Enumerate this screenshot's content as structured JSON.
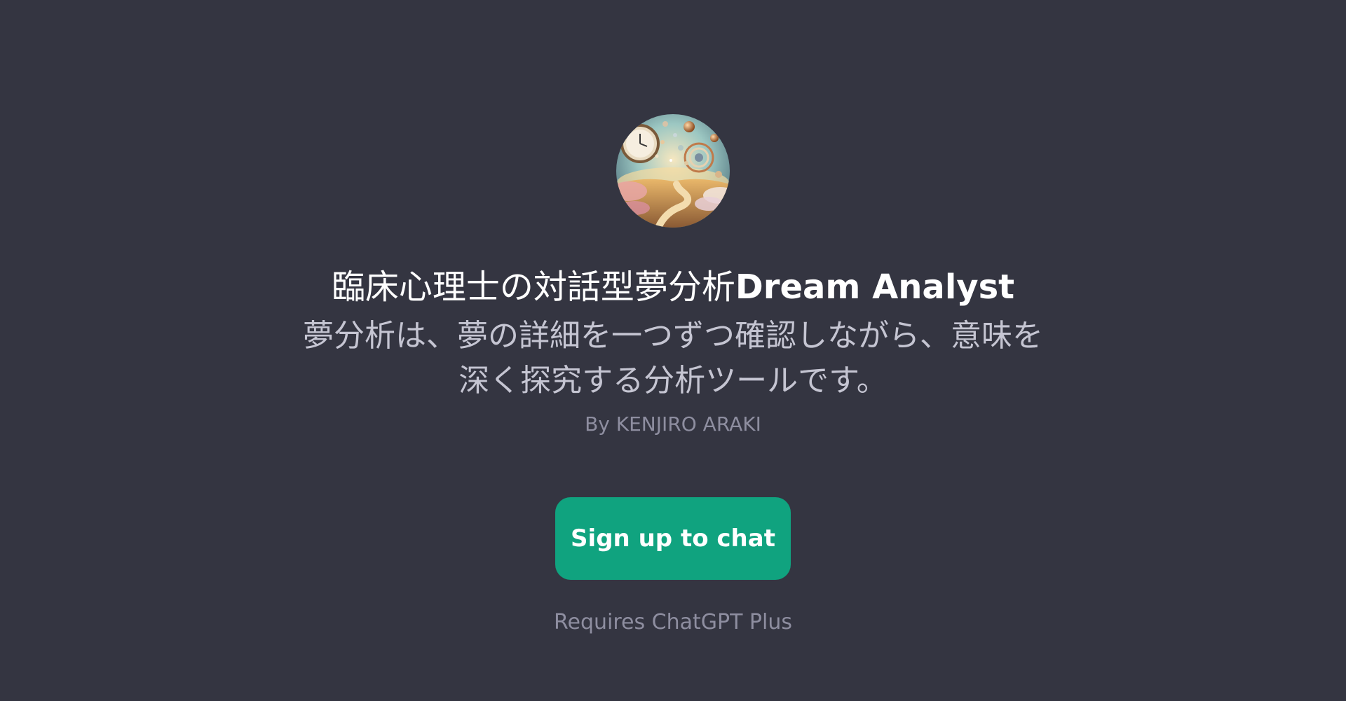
{
  "gpt": {
    "title_jp": "臨床心理士の対話型夢分析",
    "title_en": "Dream Analyst",
    "description": "夢分析は、夢の詳細を一つずつ確認しながら、意味を深く探究する分析ツールです。",
    "author": "By KENJIRO ARAKI",
    "avatar_icon": "dream-landscape-avatar-icon"
  },
  "actions": {
    "signup_label": "Sign up to chat"
  },
  "footer": {
    "requires": "Requires ChatGPT Plus"
  },
  "colors": {
    "background": "#343541",
    "button": "#10a37f",
    "title": "#ffffff",
    "description": "#c5c5d2",
    "muted": "#8e8ea0"
  }
}
